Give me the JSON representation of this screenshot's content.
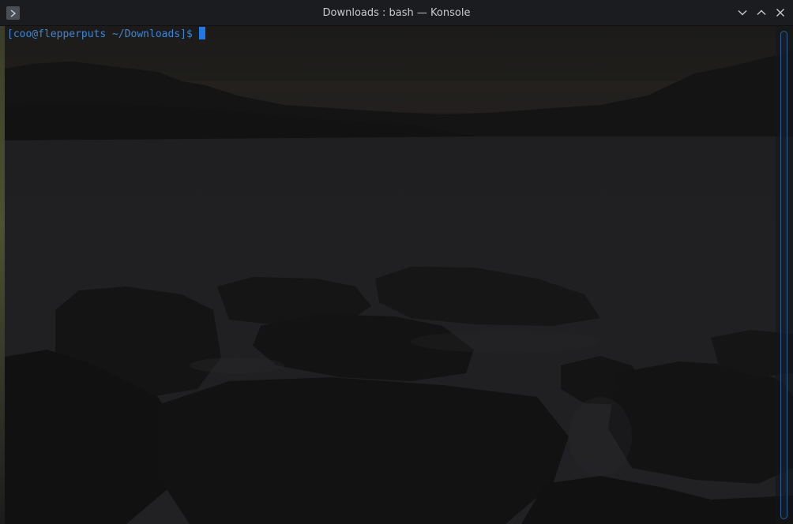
{
  "window": {
    "title": "Downloads : bash — Konsole"
  },
  "titlebar": {
    "app_icon": "konsole-icon",
    "buttons": [
      "minimize-icon",
      "maximize-icon",
      "close-icon"
    ]
  },
  "terminal": {
    "prompt": "[coo@flepperputs ~/Downloads]$",
    "cursor": "block-cursor",
    "background": "rocky-shore-at-dusk-wallpaper",
    "colors": {
      "prompt": "#3c86d8",
      "cursor": "#1d7ae6",
      "scrollbar": "#2c5d96"
    }
  }
}
